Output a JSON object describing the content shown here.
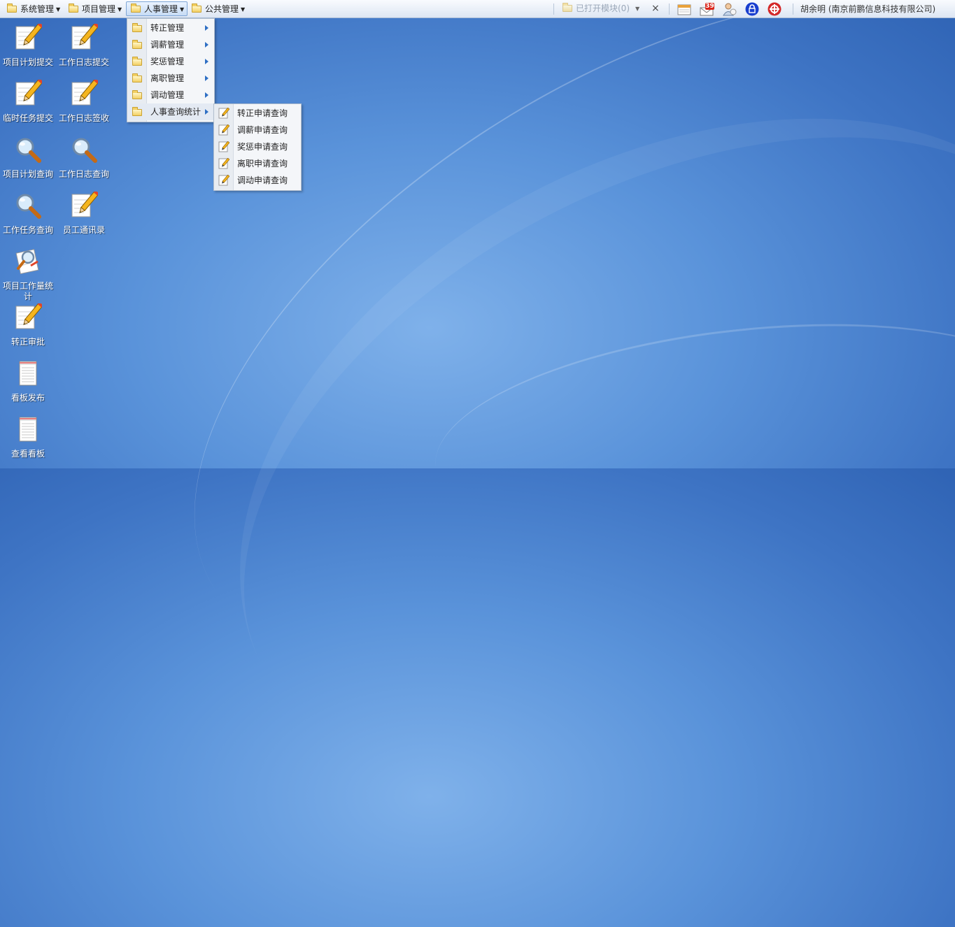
{
  "menubar": {
    "items": [
      {
        "label": "系统管理"
      },
      {
        "label": "项目管理"
      },
      {
        "label": "人事管理"
      },
      {
        "label": "公共管理"
      }
    ],
    "opened_modules": "已打开模块(0)",
    "close_symbol": "×",
    "mail_count": "39",
    "user": "胡余明 (南京前鹏信息科技有限公司)"
  },
  "desktop": {
    "icons": [
      {
        "label": "项目计划提交",
        "icon": "pencil-paper-icon"
      },
      {
        "label": "工作日志提交",
        "icon": "pencil-paper-icon"
      },
      {
        "label": "临时任务提交",
        "icon": "pencil-paper-icon"
      },
      {
        "label": "工作日志签收",
        "icon": "pencil-paper-icon"
      },
      {
        "label": "项目计划查询",
        "icon": "magnifier-icon"
      },
      {
        "label": "工作日志查询",
        "icon": "magnifier-icon"
      },
      {
        "label": "工作任务查询",
        "icon": "magnifier-icon"
      },
      {
        "label": "员工通讯录",
        "icon": "pencil-paper-icon"
      },
      {
        "label": "项目工作量统计",
        "icon": "magnifier-paper-icon"
      },
      {
        "label": "转正审批",
        "icon": "pencil-paper-icon"
      },
      {
        "label": "看板发布",
        "icon": "notepad-icon"
      },
      {
        "label": "查看看板",
        "icon": "notepad-icon"
      }
    ]
  },
  "hr_menu": {
    "items": [
      {
        "label": "转正管理"
      },
      {
        "label": "调薪管理"
      },
      {
        "label": "奖惩管理"
      },
      {
        "label": "离职管理"
      },
      {
        "label": "调动管理"
      },
      {
        "label": "人事查询统计"
      }
    ]
  },
  "hr_query_submenu": {
    "items": [
      {
        "label": "转正申请查询"
      },
      {
        "label": "调薪申请查询"
      },
      {
        "label": "奖惩申请查询"
      },
      {
        "label": "离职申请查询"
      },
      {
        "label": "调动申请查询"
      }
    ]
  },
  "colors": {
    "desktop_blue": "#4a82d0",
    "menu_bg": "#f4f6f9",
    "accent": "#2e6fc4"
  }
}
